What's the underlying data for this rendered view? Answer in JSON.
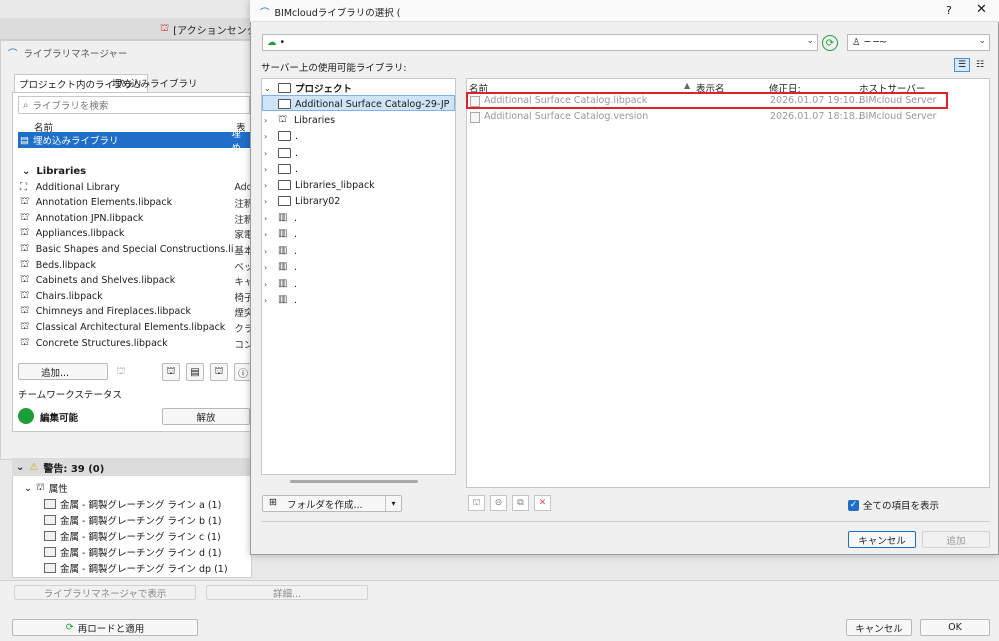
{
  "background": {
    "action_center": "[アクションセンター]"
  },
  "library_manager": {
    "title": "ライブラリマネージャー",
    "tabs": [
      "プロジェクト内のライブラリ",
      "埋め込みライブラリ"
    ],
    "search_placeholder": "ライブラリを検索",
    "columns": {
      "name": "名前",
      "display": "表示"
    },
    "embedded": {
      "name": "埋め込みライブラリ",
      "display": "埋め"
    },
    "section": "Libraries",
    "libraries": [
      {
        "name": "Additional Library",
        "display": "Add"
      },
      {
        "name": "Annotation Elements.libpack",
        "display": "注釈"
      },
      {
        "name": "Annotation JPN.libpack",
        "display": "注釈"
      },
      {
        "name": "Appliances.libpack",
        "display": "家電"
      },
      {
        "name": "Basic Shapes and Special Constructions.libp...",
        "display": "基本"
      },
      {
        "name": "Beds.libpack",
        "display": "ベッ"
      },
      {
        "name": "Cabinets and Shelves.libpack",
        "display": "キャ"
      },
      {
        "name": "Chairs.libpack",
        "display": "椅子"
      },
      {
        "name": "Chimneys and Fireplaces.libpack",
        "display": "煙突"
      },
      {
        "name": "Classical Architectural Elements.libpack",
        "display": "クラ"
      },
      {
        "name": "Concrete Structures.libpack",
        "display": "コン"
      }
    ],
    "add_button": "追加...",
    "teamwork_label": "チームワークステータス",
    "status": "編集可能",
    "release_button": "解放"
  },
  "warnings": {
    "header": "警告: 39 (0)",
    "group": "属性",
    "items": [
      "金属 - 鋼製グレーチング ライン a (1)",
      "金属 - 鋼製グレーチング ライン b (1)",
      "金属 - 鋼製グレーチング ライン c (1)",
      "金属 - 鋼製グレーチング ライン d (1)",
      "金属 - 鋼製グレーチング ライン dp (1)"
    ]
  },
  "bottom": {
    "show_in_lm": "ライブラリマネージャで表示",
    "details": "詳細...",
    "reload": "再ロードと適用",
    "cancel": "キャンセル",
    "ok": "OK"
  },
  "dialog": {
    "title": "BIMcloudライブラリの選択 (",
    "help": "?",
    "close": "✕",
    "server_value": "•",
    "user_value": "─ ─~",
    "available_label": "サーバー上の使用可能ライブラリ:",
    "tree": {
      "root": "プロジェクト",
      "selected": "Additional Surface Catalog-29-JPN-3",
      "libraries": "Libraries",
      "libraries_libpack": "Libraries_libpack",
      "library02": "Library02",
      "redacted_label": "."
    },
    "columns": [
      "名前",
      "表示名",
      "修正日:",
      "ホストサーバー"
    ],
    "files": [
      {
        "name": "Additional Surface Catalog.libpack",
        "display": "",
        "modified": "2026.01.07 19:10...",
        "host": "BIMcloud Server"
      },
      {
        "name": "Additional Surface Catalog.version",
        "display": "",
        "modified": "2026.01.07 18:18...",
        "host": "BIMcloud Server"
      }
    ],
    "create_folder": "フォルダを作成...",
    "show_all": "全ての項目を表示",
    "cancel": "キャンセル",
    "add": "追加"
  }
}
